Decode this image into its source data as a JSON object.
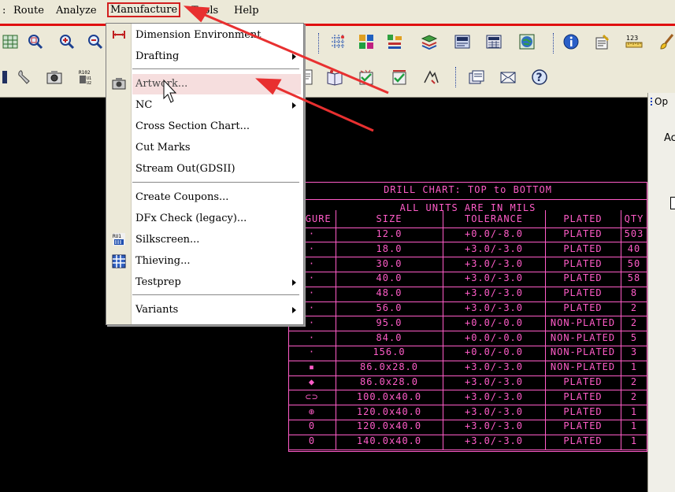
{
  "menubar": {
    "items": [
      {
        "label": "Route"
      },
      {
        "label": "Analyze"
      },
      {
        "label": "Manufacture"
      },
      {
        "label": "Tools"
      },
      {
        "label": "Help"
      }
    ]
  },
  "dropdown": {
    "items": [
      {
        "label": "Dimension Environment",
        "icon": "dimension-icon"
      },
      {
        "label": "Drafting",
        "submenu": true
      },
      {
        "label": "Artwork...",
        "icon": "camera-icon",
        "highlighted": true
      },
      {
        "label": "NC",
        "submenu": true
      },
      {
        "label": "Cross Section Chart..."
      },
      {
        "label": "Cut Marks"
      },
      {
        "label": "Stream Out(GDSII)"
      },
      {
        "label": "Create Coupons..."
      },
      {
        "label": "DFx Check (legacy)..."
      },
      {
        "label": "Silkscreen...",
        "icon": "silkscreen-icon"
      },
      {
        "label": "Thieving...",
        "icon": "thieving-icon"
      },
      {
        "label": "Testprep",
        "submenu": true
      },
      {
        "label": "Variants",
        "submenu": true
      }
    ]
  },
  "right_panel": {
    "title": "Op",
    "label": "Ac"
  },
  "drill_table": {
    "title": "DRILL CHART: TOP to BOTTOM",
    "subtitle": "ALL UNITS ARE IN MILS",
    "headers": [
      "FIGURE",
      "SIZE",
      "TOLERANCE",
      "PLATED",
      "QTY"
    ],
    "rows": [
      [
        "·",
        "12.0",
        "+0.0/-8.0",
        "PLATED",
        "503"
      ],
      [
        "·",
        "18.0",
        "+3.0/-3.0",
        "PLATED",
        "40"
      ],
      [
        "·",
        "30.0",
        "+3.0/-3.0",
        "PLATED",
        "50"
      ],
      [
        "·",
        "40.0",
        "+3.0/-3.0",
        "PLATED",
        "58"
      ],
      [
        "·",
        "48.0",
        "+3.0/-3.0",
        "PLATED",
        "8"
      ],
      [
        "·",
        "56.0",
        "+3.0/-3.0",
        "PLATED",
        "2"
      ],
      [
        "·",
        "95.0",
        "+0.0/-0.0",
        "NON-PLATED",
        "2"
      ],
      [
        "·",
        "84.0",
        "+0.0/-0.0",
        "NON-PLATED",
        "5"
      ],
      [
        "·",
        "156.0",
        "+0.0/-0.0",
        "NON-PLATED",
        "3"
      ],
      [
        "▪",
        "86.0x28.0",
        "+3.0/-3.0",
        "NON-PLATED",
        "1"
      ],
      [
        "◆",
        "86.0x28.0",
        "+3.0/-3.0",
        "PLATED",
        "2"
      ],
      [
        "⊂⊃",
        "100.0x40.0",
        "+3.0/-3.0",
        "PLATED",
        "2"
      ],
      [
        "⊕",
        "120.0x40.0",
        "+3.0/-3.0",
        "PLATED",
        "1"
      ],
      [
        "0",
        "120.0x40.0",
        "+3.0/-3.0",
        "PLATED",
        "1"
      ],
      [
        "0",
        "140.0x40.0",
        "+3.0/-3.0",
        "PLATED",
        "1"
      ]
    ]
  },
  "toolbar_icons": [
    "grid-icon",
    "zoom-fit-icon",
    "zoom-in-icon",
    "zoom-out-icon",
    "grid-snap-icon",
    "color-palette-icon",
    "stackup-icon",
    "layers-icon",
    "cam-icon",
    "dfa-icon",
    "globe-icon",
    "info-icon",
    "property-icon",
    "measure-icon",
    "paint-brush-icon",
    "wrench-icon",
    "camera-icon",
    "refdes-icon",
    "note-icon",
    "book-icon",
    "check-icon",
    "analyze-icon",
    "document-icon",
    "envelope-icon",
    "help-icon"
  ],
  "colors": {
    "menu_highlight": "#f6dede",
    "annotation": "#e83030",
    "drill_table": "#ff5cc8",
    "chrome": "#ece9d8"
  }
}
